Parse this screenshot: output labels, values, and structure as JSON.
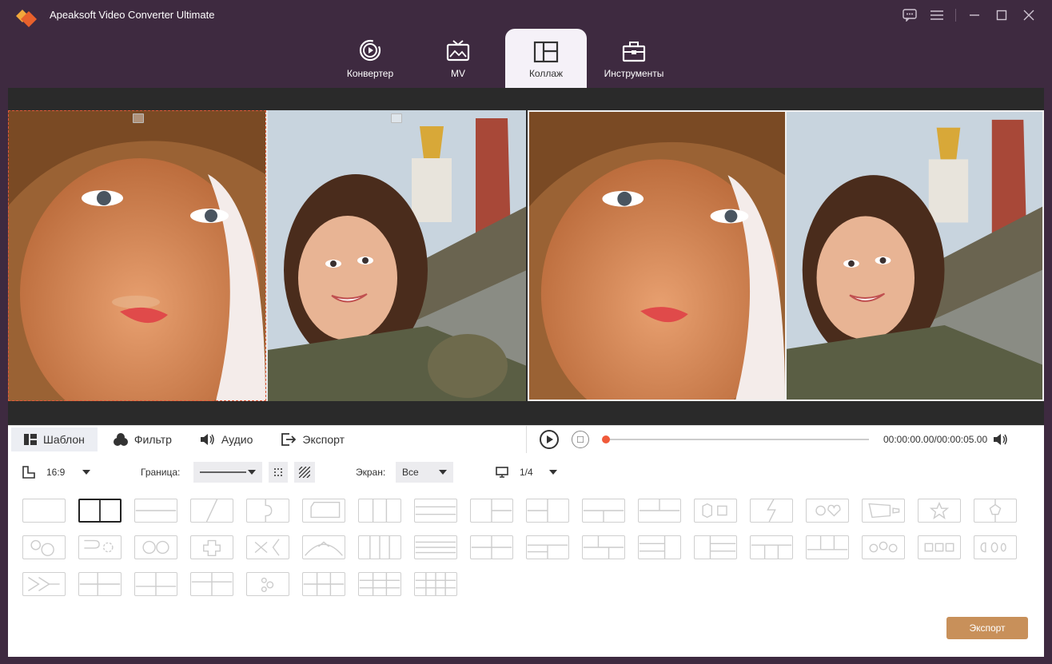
{
  "app": {
    "title": "Apeaksoft Video Converter Ultimate"
  },
  "main_tabs": [
    {
      "label": "Конвертер",
      "icon": "converter-icon"
    },
    {
      "label": "MV",
      "icon": "tv-icon"
    },
    {
      "label": "Коллаж",
      "icon": "collage-icon",
      "active": true
    },
    {
      "label": "Инструменты",
      "icon": "toolbox-icon"
    }
  ],
  "sub_tabs": [
    {
      "label": "Шаблон",
      "icon": "template-icon",
      "active": true
    },
    {
      "label": "Фильтр",
      "icon": "filter-icon"
    },
    {
      "label": "Аудио",
      "icon": "audio-icon"
    },
    {
      "label": "Экспорт",
      "icon": "export-icon"
    }
  ],
  "player": {
    "time": "00:00:00.00/00:00:05.00",
    "progress": 0
  },
  "options": {
    "ratio": "16:9",
    "border_label": "Граница:",
    "screen_label": "Экран:",
    "screen_value": "Все",
    "page": "1/4"
  },
  "export_button": "Экспорт",
  "colors": {
    "accent": "#c8905a",
    "titlebar": "#3e2a40",
    "seek": "#f05a3a"
  }
}
